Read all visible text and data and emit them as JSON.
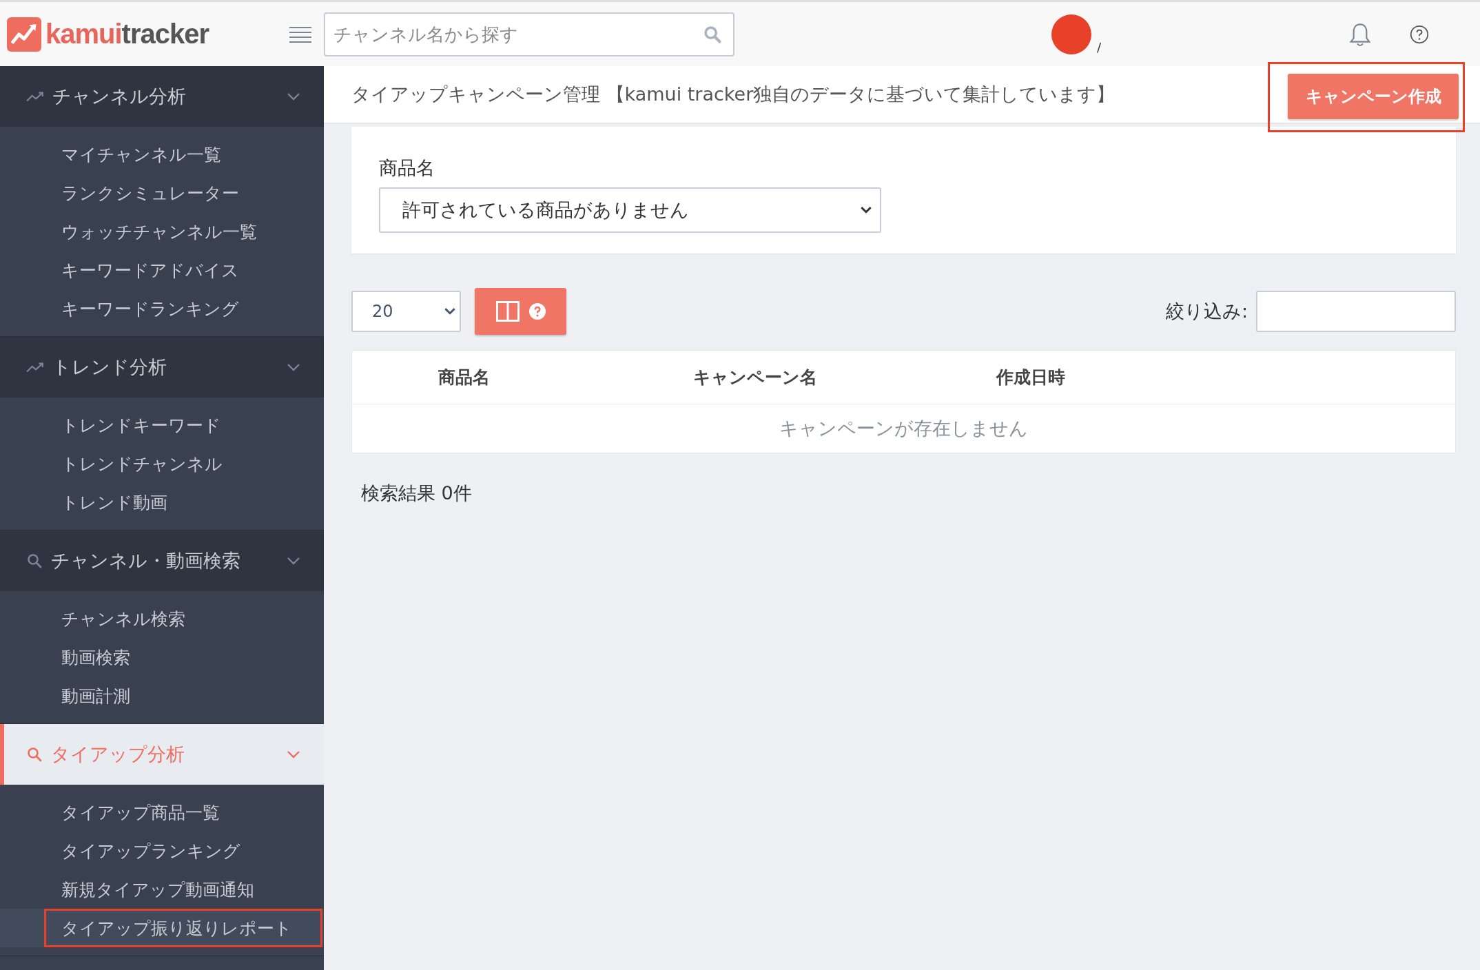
{
  "header": {
    "logo_text": {
      "part_1": "kamui",
      "part_2": "tracker"
    },
    "search": {
      "placeholder": "チャンネル名から探す"
    },
    "user_name": "/"
  },
  "sidebar": {
    "groups": [
      {
        "label": "チャンネル分析",
        "kind": "trend",
        "expanded": true,
        "selected": false,
        "items": [
          {
            "label": "マイチャンネル一覧",
            "selected": false,
            "highlighted": false
          },
          {
            "label": "ランクシミュレーター",
            "selected": false,
            "highlighted": false
          },
          {
            "label": "ウォッチチャンネル一覧",
            "selected": false,
            "highlighted": false
          },
          {
            "label": "キーワードアドバイス",
            "selected": false,
            "highlighted": false
          },
          {
            "label": "キーワードランキング",
            "selected": false,
            "highlighted": false
          }
        ]
      },
      {
        "label": "トレンド分析",
        "kind": "trend",
        "expanded": true,
        "selected": false,
        "items": [
          {
            "label": "トレンドキーワード",
            "selected": false,
            "highlighted": false
          },
          {
            "label": "トレンドチャンネル",
            "selected": false,
            "highlighted": false
          },
          {
            "label": "トレンド動画",
            "selected": false,
            "highlighted": false
          }
        ]
      },
      {
        "label": "チャンネル・動画検索",
        "kind": "search",
        "expanded": true,
        "selected": false,
        "items": [
          {
            "label": "チャンネル検索",
            "selected": false,
            "highlighted": false
          },
          {
            "label": "動画検索",
            "selected": false,
            "highlighted": false
          },
          {
            "label": "動画計測",
            "selected": false,
            "highlighted": false
          }
        ]
      },
      {
        "label": "タイアップ分析",
        "kind": "search",
        "expanded": true,
        "selected": true,
        "items": [
          {
            "label": "タイアップ商品一覧",
            "selected": false,
            "highlighted": false
          },
          {
            "label": "タイアップランキング",
            "selected": false,
            "highlighted": false
          },
          {
            "label": "新規タイアップ動画通知",
            "selected": false,
            "highlighted": false
          },
          {
            "label": "タイアップ振り返りレポート",
            "selected": true,
            "highlighted": true
          }
        ]
      }
    ]
  },
  "page": {
    "title": "タイアップキャンペーン管理 【kamui tracker独自のデータに基づいて集計しています】",
    "create_button": {
      "label": "キャンペーン作成",
      "highlighted": true
    },
    "product_filter": {
      "label": "商品名",
      "value": "許可されている商品がありません"
    },
    "page_size": "20",
    "filter_label": "絞り込み:",
    "table": {
      "columns": [
        "商品名",
        "キャンペーン名",
        "作成日時"
      ],
      "empty_message": "キャンペーンが存在しません"
    },
    "result_count": "検索結果 0件"
  }
}
